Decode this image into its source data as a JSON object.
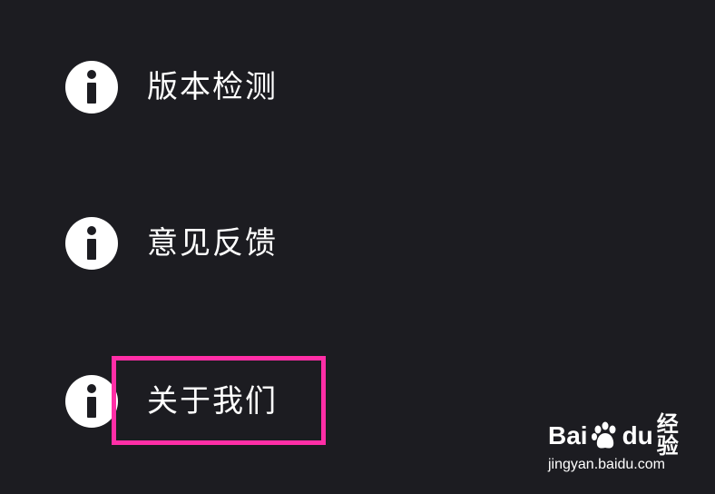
{
  "menu": {
    "items": [
      {
        "label": "版本检测",
        "icon": "info-icon"
      },
      {
        "label": "意见反馈",
        "icon": "info-icon"
      },
      {
        "label": "关于我们",
        "icon": "info-icon",
        "highlighted": true
      }
    ]
  },
  "highlight": {
    "color": "#ff2ea6"
  },
  "watermark": {
    "logo_left": "Bai",
    "logo_right": "du",
    "logo_suffix": "经验",
    "url": "jingyan.baidu.com"
  },
  "colors": {
    "background": "#1c1c21",
    "text": "#ffffff",
    "icon_bg": "#ffffff",
    "icon_fg": "#1c1c21"
  }
}
